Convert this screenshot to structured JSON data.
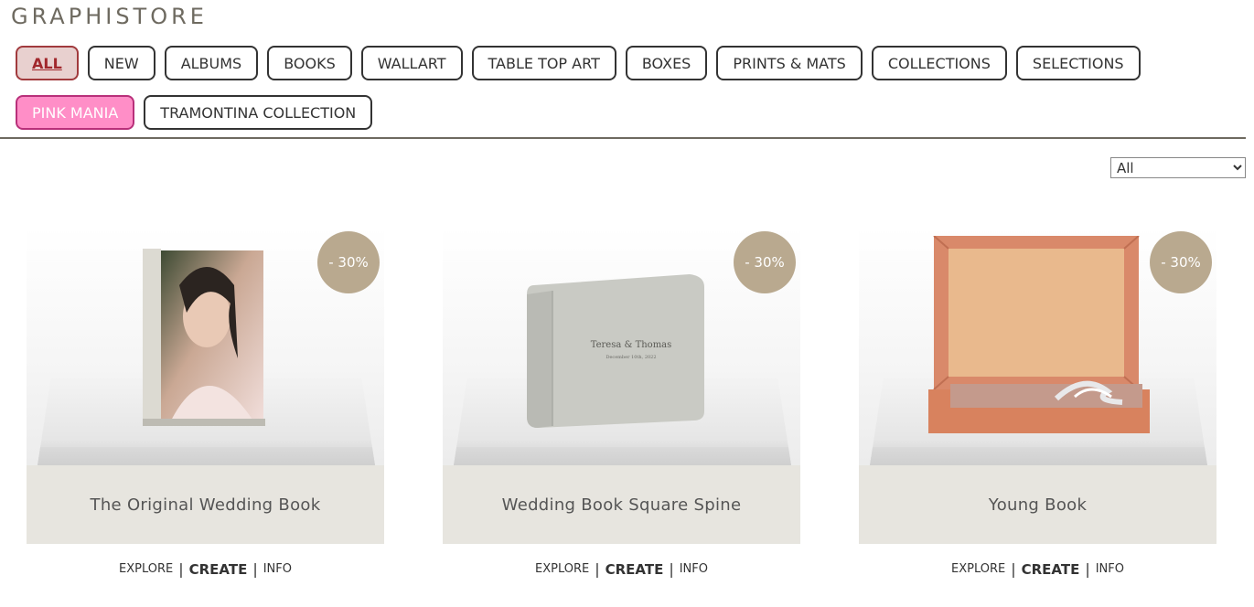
{
  "brand": {
    "logo_text": "GRAPHISTORE"
  },
  "filters": [
    {
      "label": "ALL",
      "state": "active"
    },
    {
      "label": "NEW",
      "state": "normal"
    },
    {
      "label": "ALBUMS",
      "state": "normal"
    },
    {
      "label": "BOOKS",
      "state": "normal"
    },
    {
      "label": "WALLART",
      "state": "normal"
    },
    {
      "label": "TABLE TOP ART",
      "state": "normal"
    },
    {
      "label": "BOXES",
      "state": "normal"
    },
    {
      "label": "PRINTS & MATS",
      "state": "normal"
    },
    {
      "label": "COLLECTIONS",
      "state": "normal"
    },
    {
      "label": "SELECTIONS",
      "state": "normal"
    },
    {
      "label": "PINK MANIA",
      "state": "highlight"
    },
    {
      "label": "TRAMONTINA COLLECTION",
      "state": "normal"
    }
  ],
  "sort": {
    "selected": "All"
  },
  "colors": {
    "accent_active_text": "#a1272c",
    "accent_active_bg": "#e8d0cf",
    "pink_mania_bg": "#ff8ec7",
    "badge_bg": "#b9a98f",
    "card_title_bg": "#e7e5df"
  },
  "products": [
    {
      "title": "The Original Wedding Book",
      "discount": "- 30%",
      "image_icon": "portrait-photo-book",
      "links": {
        "explore": "EXPLORE",
        "create": "CREATE",
        "info": "INFO"
      }
    },
    {
      "title": "Wedding Book Square Spine",
      "discount": "- 30%",
      "image_icon": "grey-linen-book",
      "cover_line1": "Teresa & Thomas",
      "cover_line2": "December 10th, 2022",
      "links": {
        "explore": "EXPLORE",
        "create": "CREATE",
        "info": "INFO"
      }
    },
    {
      "title": "Young Book",
      "discount": "- 30%",
      "image_icon": "open-presentation-box",
      "links": {
        "explore": "EXPLORE",
        "create": "CREATE",
        "info": "INFO"
      }
    }
  ]
}
